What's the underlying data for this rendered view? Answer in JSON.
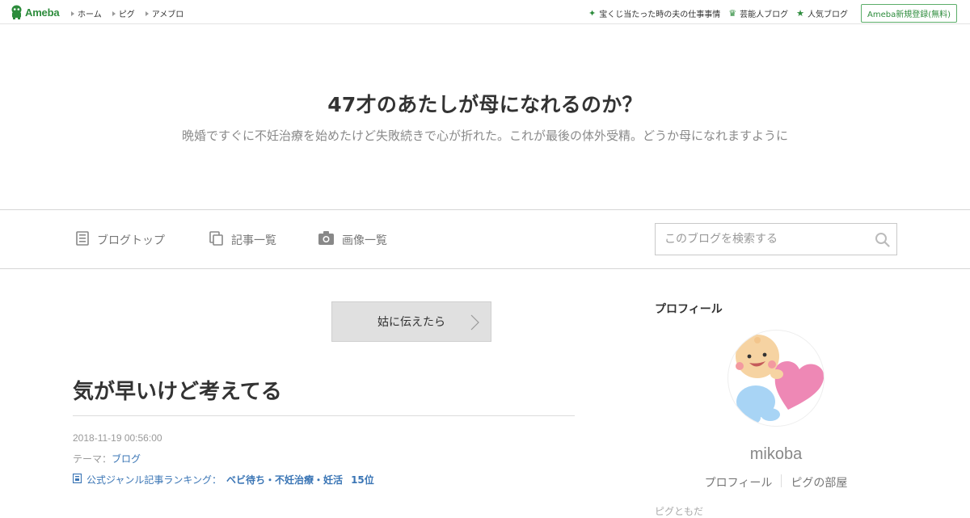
{
  "topbar": {
    "logo_text": "Ameba",
    "nav": [
      "ホーム",
      "ピグ",
      "アメブロ"
    ],
    "right_links": [
      {
        "label": "宝くじ当たった時の夫の仕事事情",
        "icon": "sparkle-icon"
      },
      {
        "label": "芸能人ブログ",
        "icon": "crown-icon"
      },
      {
        "label": "人気ブログ",
        "icon": "star-icon"
      }
    ],
    "signup_label": "Ameba新規登録(無料)"
  },
  "header": {
    "title": "47才のあたしが母になれるのか？",
    "description": "晩婚ですぐに不妊治療を始めたけど失敗続きで心が折れた。これが最後の体外受精。どうか母になれますように"
  },
  "nav": {
    "blog_top": "ブログトップ",
    "entries": "記事一覧",
    "images": "画像一覧",
    "search_placeholder": "このブログを検索する"
  },
  "entry": {
    "prev_title": "姑に伝えたら",
    "title": "気が早いけど考えてる",
    "date": "2018-11-19 00:56:00",
    "theme_label": "テーマ：",
    "theme_value": "ブログ",
    "ranking_label": "公式ジャンル記事ランキング：",
    "ranking_genre": "ベビ待ち・不妊治療・妊活",
    "ranking_position": "15位"
  },
  "sidebar": {
    "heading": "プロフィール",
    "username": "mikoba",
    "links": [
      "プロフィール",
      "ピグの部屋"
    ],
    "cut_text": "ピグともだ"
  },
  "colors": {
    "brand_green": "#2d8c3c",
    "link_blue": "#3a75b5",
    "muted_text": "#8a8a8a"
  }
}
